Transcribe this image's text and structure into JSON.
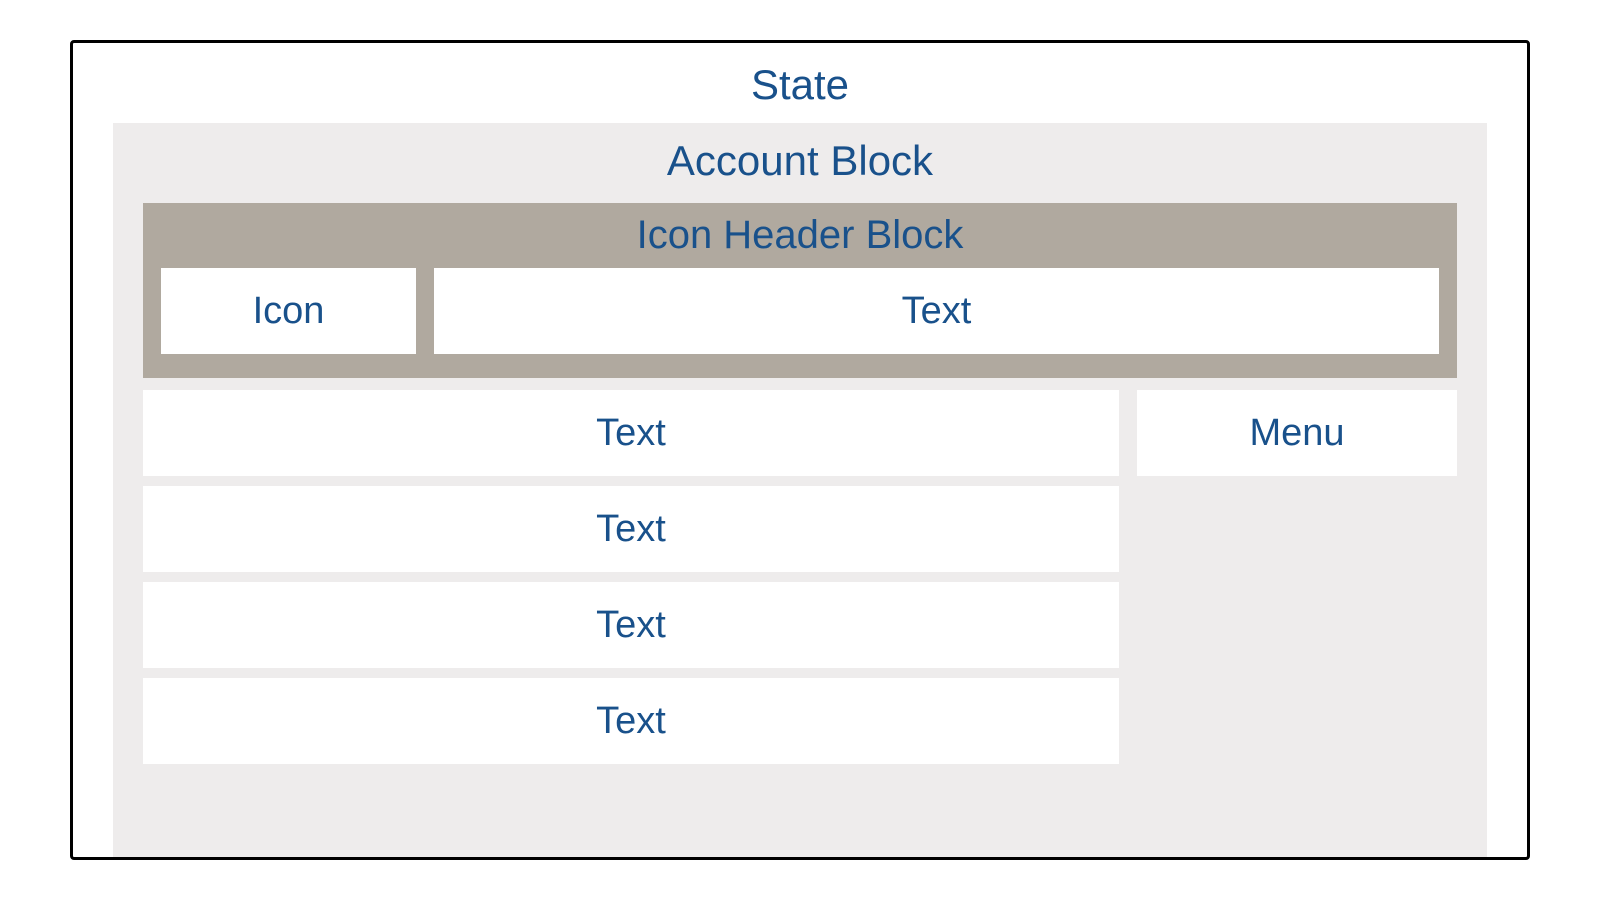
{
  "state": {
    "title": "State"
  },
  "account_block": {
    "title": "Account Block",
    "icon_header": {
      "title": "Icon Header Block",
      "icon_label": "Icon",
      "text_label": "Text"
    },
    "text_rows": [
      {
        "label": "Text"
      },
      {
        "label": "Text"
      },
      {
        "label": "Text"
      },
      {
        "label": "Text"
      }
    ],
    "menu": {
      "label": "Menu"
    }
  },
  "colors": {
    "text": "#19518b",
    "outer_bg": "#eeecec",
    "header_bg": "#b0a99f",
    "cell_bg": "#ffffff",
    "border": "#000000"
  }
}
